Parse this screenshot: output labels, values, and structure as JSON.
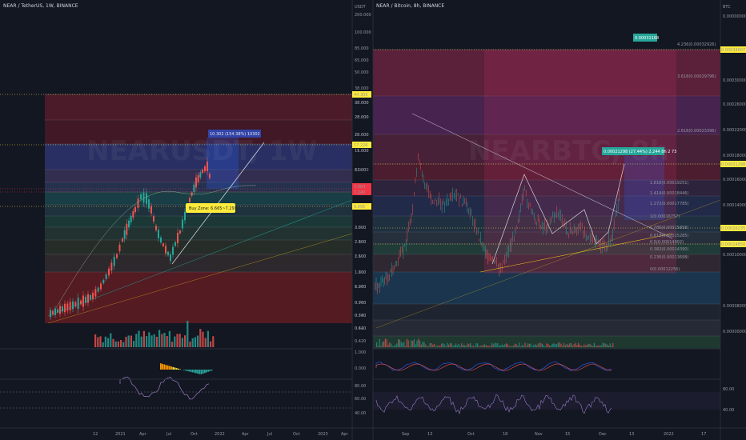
{
  "left_panel": {
    "header": "NEAR / TetherUS, 1W, BINANCE",
    "watermark": "NEARUSDT, 1W",
    "price_axis": [
      "44.305",
      "38.000",
      "28.000",
      "20.000",
      "15.000",
      "11.000",
      "8.000",
      "6.695",
      "3.800",
      "2.800",
      "2.100",
      "1.600",
      "1.200",
      "0.960",
      "0.700",
      "0.540",
      "0.420"
    ],
    "price_tags": [
      {
        "text": "44.305",
        "color": "#ffeb3b"
      },
      {
        "text": "17.226",
        "color": "#ffeb3b"
      },
      {
        "text": "7.983",
        "color": "#f23645"
      },
      {
        "text": "7.240",
        "color": "#f23645"
      },
      {
        "text": "6.695",
        "color": "#ffeb3b"
      }
    ],
    "time_axis": [
      "12",
      "2021",
      "Apr",
      "Jul",
      "Oct",
      "2022",
      "Apr",
      "Jul",
      "Oct",
      "2023",
      "Apr"
    ],
    "buy_zone_label": "Buy Zone: 6.665~7.293",
    "target_label": "10.302 (154.38%) 10302",
    "macd_axis": [],
    "rsi_axis": []
  },
  "right_panel": {
    "header": "NEAR / Bitcoin, 8h, BINANCE",
    "watermark": "NEARBTC, 8h",
    "price_axis_top": [
      "USDT",
      "200.000",
      "100.000",
      "85.000",
      "65.000",
      "50.000",
      "38.000",
      "28.000",
      "20.000",
      "15.000",
      "11.000",
      "8.000",
      "6.000",
      "3.800",
      "2.800",
      "2.100",
      "1.600",
      "1.200",
      "0.960",
      "0.700",
      "0.540",
      "0.420"
    ],
    "price_axis_mid": [
      "1.000",
      "0.000"
    ],
    "price_axis_rsi": [
      "80.00",
      "60.00",
      "40.00"
    ],
    "btc_axis": [
      "BTC",
      "0.00000000",
      "0.00032000",
      "0.00030000",
      "0.00026000",
      "0.00022000",
      "0.00018000",
      "0.00016000",
      "0.00014000",
      "0.00012000",
      "0.00010000",
      "0.00008000",
      "0.00000000"
    ],
    "price_tags": [
      {
        "text": "0.00034007",
        "color": "#ffeb3b"
      },
      {
        "text": "0.00021298",
        "color": "#ffeb3b"
      },
      {
        "text": "0.00016235",
        "color": "#ffeb3b"
      },
      {
        "text": "0.00014850",
        "color": "#ffeb3b"
      }
    ],
    "rsi_axis": [
      "80.00",
      "40.00"
    ],
    "time_axis": [
      "Sep",
      "13",
      "Oct",
      "18",
      "Nov",
      "15",
      "Dec",
      "13",
      "2022",
      "17"
    ],
    "top_label": "0.00031168",
    "target_label": "0.00021298 (27.44%) 2.244 8h 2 73",
    "fib_labels": [
      "4.236(0.00032926)",
      "3.618(0.00029796)",
      "2.618(0.00023396)",
      "1.618(0.00019251)",
      "1.414(0.00018446)",
      "1.272(0.00017785)",
      "1(0.00016757)",
      "0.786(0.00015858)",
      "0.618(0.00015285)",
      "0.5(0.00014902)",
      "0.382(0.00014390)",
      "0.236(0.00013698)",
      "0(0.00012256)"
    ]
  }
}
